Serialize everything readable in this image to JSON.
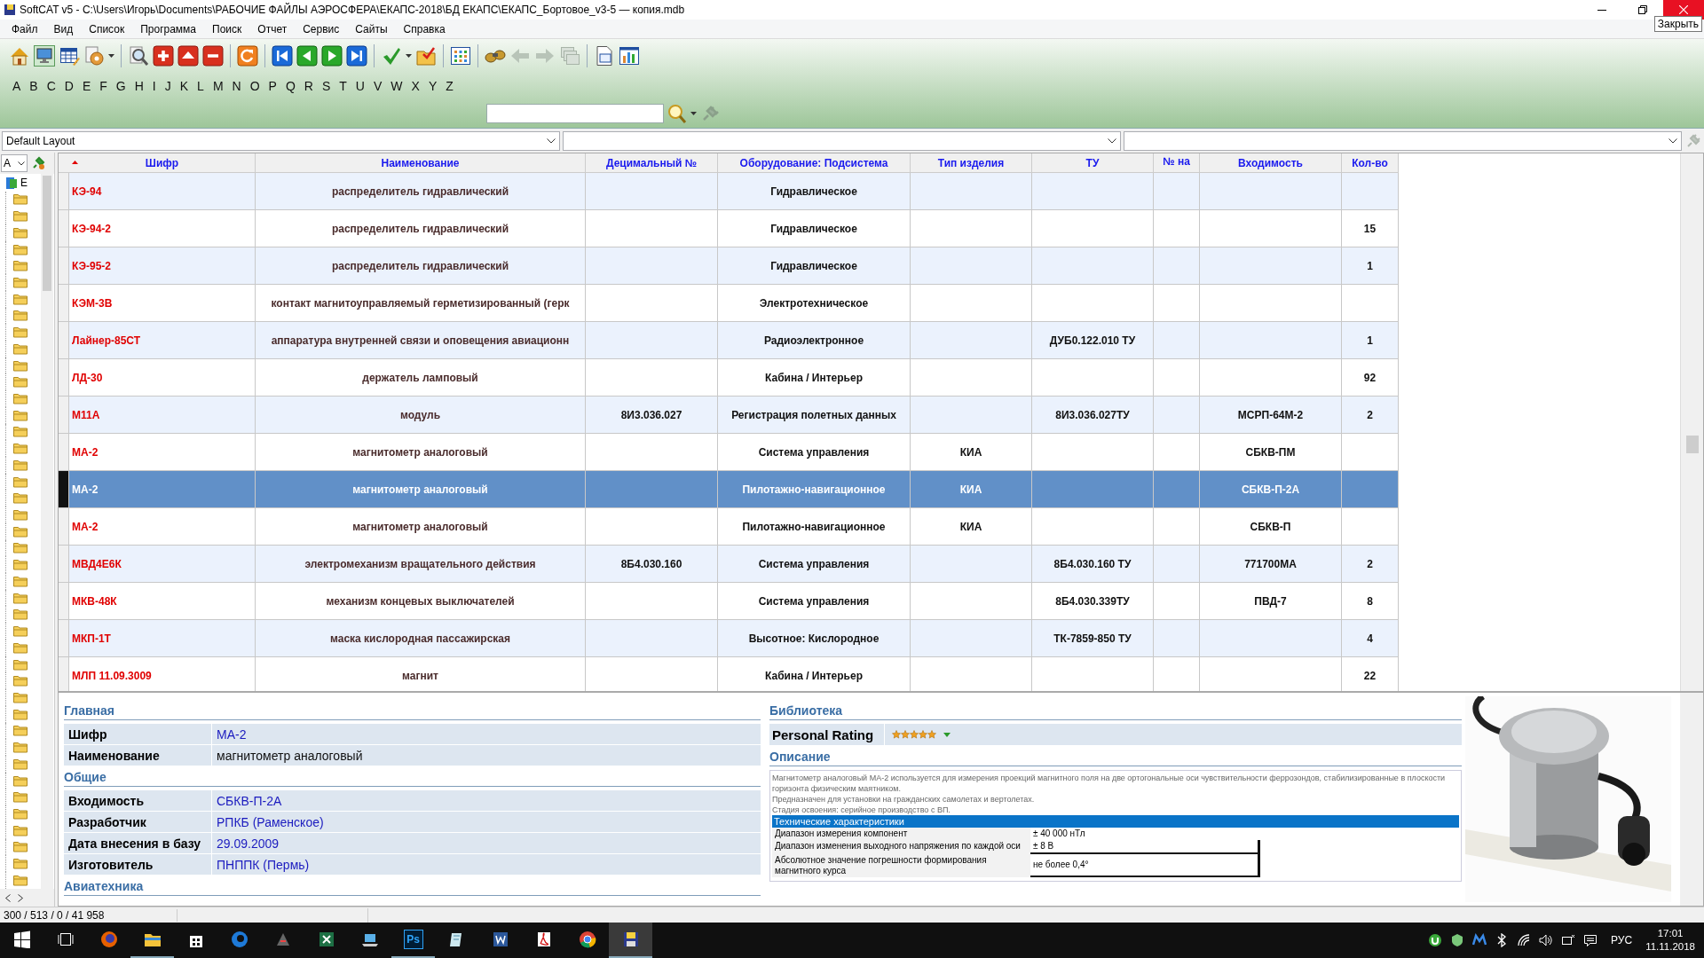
{
  "window": {
    "title": "SoftCAT v5 - C:\\Users\\Игорь\\Documents\\РАБОЧИЕ ФАЙЛЫ АЭРОСФЕРА\\ЕКАПС-2018\\БД ЕКАПС\\ЕКАПС_Бортовое_v3-5 — копия.mdb",
    "tooltip": "Закрыть"
  },
  "menu": [
    "Файл",
    "Вид",
    "Список",
    "Программа",
    "Поиск",
    "Отчет",
    "Сервис",
    "Сайты",
    "Справка"
  ],
  "letters": [
    "A",
    "B",
    "C",
    "D",
    "E",
    "F",
    "G",
    "H",
    "I",
    "J",
    "K",
    "L",
    "M",
    "N",
    "O",
    "P",
    "Q",
    "R",
    "S",
    "T",
    "U",
    "V",
    "W",
    "X",
    "Y",
    "Z"
  ],
  "layout_bar": {
    "layout": "Default Layout"
  },
  "tree": {
    "filter": "A",
    "root": "Е"
  },
  "table": {
    "columns": [
      {
        "label": "Шифр",
        "sorted": true
      },
      {
        "label": "Наименование",
        "sorted": false
      },
      {
        "label": "Децимальный №",
        "sorted": false
      },
      {
        "label": "Оборудование: Подсистема",
        "sorted": false
      },
      {
        "label": "Тип изделия",
        "sorted": false
      },
      {
        "label": "ТУ",
        "sorted": false
      },
      {
        "label": "№ на",
        "sorted": false
      },
      {
        "label": "Входимость",
        "sorted": false
      },
      {
        "label": "Кол-во",
        "sorted": false
      }
    ],
    "rows": [
      {
        "selected": false,
        "cells": [
          "КЭ-94",
          "распределитель гидравлический",
          null,
          "Гидравлическое",
          null,
          null,
          null,
          null,
          null
        ]
      },
      {
        "selected": false,
        "cells": [
          "КЭ-94-2",
          "распределитель гидравлический",
          null,
          "Гидравлическое",
          null,
          null,
          null,
          null,
          "15"
        ]
      },
      {
        "selected": false,
        "cells": [
          "КЭ-95-2",
          "распределитель гидравлический",
          null,
          "Гидравлическое",
          null,
          null,
          null,
          null,
          "1"
        ]
      },
      {
        "selected": false,
        "cells": [
          "КЭМ-3В",
          "контакт магнитоуправляемый герметизированный (герк",
          null,
          "Электротехническое",
          null,
          null,
          null,
          null,
          null
        ]
      },
      {
        "selected": false,
        "cells": [
          "Лайнер-85СТ",
          "аппаратура внутренней связи и оповещения авиационн",
          null,
          "Радиоэлектронное",
          null,
          "ДУБ0.122.010 ТУ",
          null,
          null,
          "1"
        ]
      },
      {
        "selected": false,
        "cells": [
          "ЛД-30",
          "держатель ламповый",
          null,
          "Кабина / Интерьер",
          null,
          null,
          null,
          null,
          "92"
        ]
      },
      {
        "selected": false,
        "cells": [
          "М11А",
          "модуль",
          "8И3.036.027",
          "Регистрация полетных данных",
          null,
          "8И3.036.027ТУ",
          null,
          "МСРП-64М-2",
          "2"
        ]
      },
      {
        "selected": false,
        "cells": [
          "МА-2",
          "магнитометр аналоговый",
          null,
          "Система управления",
          "КИА",
          null,
          null,
          "СБКВ-ПМ",
          null
        ]
      },
      {
        "selected": true,
        "cells": [
          "МА-2",
          "магнитометр аналоговый",
          null,
          "Пилотажно-навигационное",
          "КИА",
          null,
          null,
          "СБКВ-П-2А",
          null
        ]
      },
      {
        "selected": false,
        "cells": [
          "МА-2",
          "магнитометр аналоговый",
          null,
          "Пилотажно-навигационное",
          "КИА",
          null,
          null,
          "СБКВ-П",
          null
        ]
      },
      {
        "selected": false,
        "cells": [
          "МВД4Е6К",
          "электромеханизм вращательного действия",
          "8Б4.030.160",
          "Система управления",
          null,
          "8Б4.030.160 ТУ",
          null,
          "771700МА",
          "2"
        ]
      },
      {
        "selected": false,
        "cells": [
          "МКВ-48К",
          "механизм концевых выключателей",
          null,
          "Система управления",
          null,
          "8Б4.030.339ТУ",
          null,
          "ПВД-7",
          "8"
        ]
      },
      {
        "selected": false,
        "cells": [
          "МКП-1Т",
          "маска кислородная пассажирская",
          null,
          "Высотное: Кислородное",
          null,
          "ТК-7859-850 ТУ",
          null,
          null,
          "4"
        ]
      },
      {
        "selected": false,
        "cells": [
          "МЛП 11.09.3009",
          "магнит",
          null,
          "Кабина / Интерьер",
          null,
          null,
          null,
          null,
          "22"
        ]
      }
    ]
  },
  "detail": {
    "sections": [
      {
        "title": "Главная",
        "fields": [
          {
            "label": "Шифр",
            "value": "МА-2"
          },
          {
            "label": "Наименование",
            "value": "магнитометр аналоговый",
            "kind": "plain"
          }
        ]
      },
      {
        "title": "Общие",
        "fields": [
          {
            "label": "Входимость",
            "value": "СБКВ-П-2А"
          },
          {
            "label": "Разработчик",
            "value": "РПКБ (Раменское)"
          },
          {
            "label": "Дата внесения в базу",
            "value": "29.09.2009"
          },
          {
            "label": "Изготовитель",
            "value": "ПНППК (Пермь)"
          }
        ]
      },
      {
        "title": "Авиатехника"
      }
    ],
    "library": {
      "title": "Библиотека",
      "rating_label": "Personal Rating",
      "stars": 5
    },
    "description": {
      "title": "Описание",
      "paragraphs": [
        "Магнитометр аналоговый МА-2 используется для измерения проекций магнитного поля на две ортогональные оси чувствительности феррозондов, стабилизированные в плоскости горизонта физическим маятником.",
        "Предназначен для установки на гражданских самолетах и вертолетах.",
        "Стадия освоения: серийное производство с ВП."
      ],
      "specs_title": "Технические характеристики",
      "specs": [
        {
          "label": "Диапазон измерения компонент",
          "value": "± 40 000 нТл"
        },
        {
          "label": "Диапазон изменения выходного напряжения по каждой оси",
          "value": "± 8 В"
        },
        {
          "label": "Абсолютное значение погрешности формирования магнитного курса",
          "value": "не более 0,4°"
        }
      ]
    }
  },
  "status_bar": {
    "counts": "300 / 513 / 0 / 41 958"
  },
  "taskbar": {
    "apps": [
      {
        "kind": "start",
        "open": false,
        "selected": false
      },
      {
        "kind": "taskview",
        "open": false,
        "selected": false
      },
      {
        "kind": "firefox",
        "open": false,
        "selected": false
      },
      {
        "kind": "explorer",
        "open": true,
        "selected": false
      },
      {
        "kind": "store",
        "open": false,
        "selected": false
      },
      {
        "kind": "edge",
        "open": false,
        "selected": false
      },
      {
        "kind": "hp",
        "open": false,
        "selected": false
      },
      {
        "kind": "excel",
        "open": false,
        "selected": false
      },
      {
        "kind": "laptop",
        "open": false,
        "selected": false
      },
      {
        "kind": "photoshop",
        "label": "Ps",
        "open": true,
        "selected": false
      },
      {
        "kind": "notepad",
        "open": false,
        "selected": false
      },
      {
        "kind": "word",
        "open": false,
        "selected": false
      },
      {
        "kind": "pdf",
        "open": false,
        "selected": false
      },
      {
        "kind": "chrome",
        "open": false,
        "selected": false
      },
      {
        "kind": "softcat",
        "open": true,
        "selected": true
      }
    ],
    "tray": {
      "language": "РУС",
      "time": "17:01",
      "date": "11.11.2018"
    }
  }
}
